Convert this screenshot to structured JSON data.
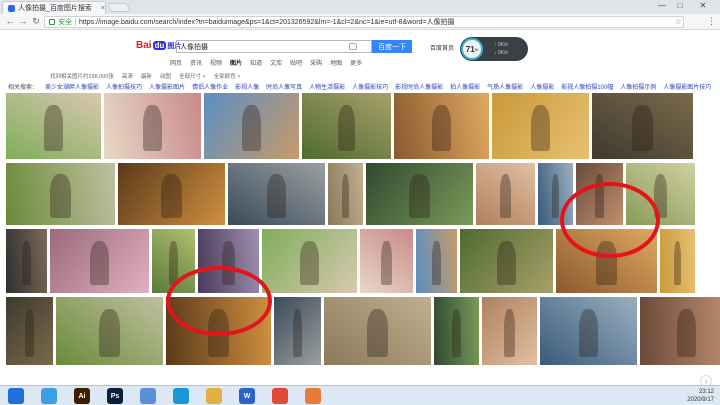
{
  "browser": {
    "tab_title": "人像拍摄_百度图片搜索",
    "tab_close": "×",
    "url_secure_label": "安全",
    "url": "https://image.baidu.com/search/index?tn=baiduimage&ps=1&ct=201326592&lm=-1&cl=2&nc=1&ie=utf-8&word=人像拍摄",
    "win_min": "—",
    "win_max": "□",
    "win_close": "✕"
  },
  "search": {
    "logo_bai": "Bai",
    "logo_du": "du",
    "logo_img": "图片",
    "query": "人像拍摄",
    "button": "百度一下",
    "home_link": "百度首页"
  },
  "speed_widget": {
    "value": "71",
    "unit": "%",
    "up": "0K/s",
    "down": "0K/s"
  },
  "nav_tabs": [
    "网页",
    "资讯",
    "视频",
    "图片",
    "知道",
    "文库",
    "贴吧",
    "采购",
    "地图",
    "更多"
  ],
  "filter_bar": [
    "找到相关图片约298,000张",
    "高清",
    "最新",
    "动图",
    "全部尺寸 ˅",
    "全部颜色 ˅"
  ],
  "related_label": "相关搜索：",
  "related": [
    "美少女湖畔人像摄影",
    "人像拍摄技巧",
    "人像摄影图片",
    "情侣人像作业",
    "影视人像",
    "时尚人像写真",
    "人物生活摄影",
    "人像摄影技巧",
    "影视时尚人像摄影",
    "拍人像摄影",
    "气质人像摄影",
    "人像摄影",
    "影视人像拍摄100幅",
    "人像拍摄示例",
    "人像摄影图片技巧"
  ],
  "taskbar": {
    "icons": [
      {
        "name": "windows-start-icon",
        "label": "",
        "color": "#1e6fd9"
      },
      {
        "name": "photo-viewer-icon",
        "label": "",
        "color": "#3aa0e0"
      },
      {
        "name": "illustrator-icon",
        "label": "Ai",
        "color": "#3a1f00"
      },
      {
        "name": "photoshop-icon",
        "label": "Ps",
        "color": "#0a1f3d"
      },
      {
        "name": "bird-app-icon",
        "label": "",
        "color": "#5b8fd6"
      },
      {
        "name": "media-app-icon",
        "label": "",
        "color": "#1996d6"
      },
      {
        "name": "folder-icon",
        "label": "",
        "color": "#e0b040"
      },
      {
        "name": "wps-icon",
        "label": "W",
        "color": "#2b64c8"
      },
      {
        "name": "chrome-icon",
        "label": "",
        "color": "#e04a3a"
      },
      {
        "name": "gallery-app-icon",
        "label": "",
        "color": "#e87a3a"
      }
    ],
    "tray_time": "23:12",
    "tray_date": "2020/9/17"
  },
  "colors": {
    "baidu_blue": "#3385ff",
    "annotation_red": "#e5141a",
    "link_blue": "#2b3fb8"
  }
}
